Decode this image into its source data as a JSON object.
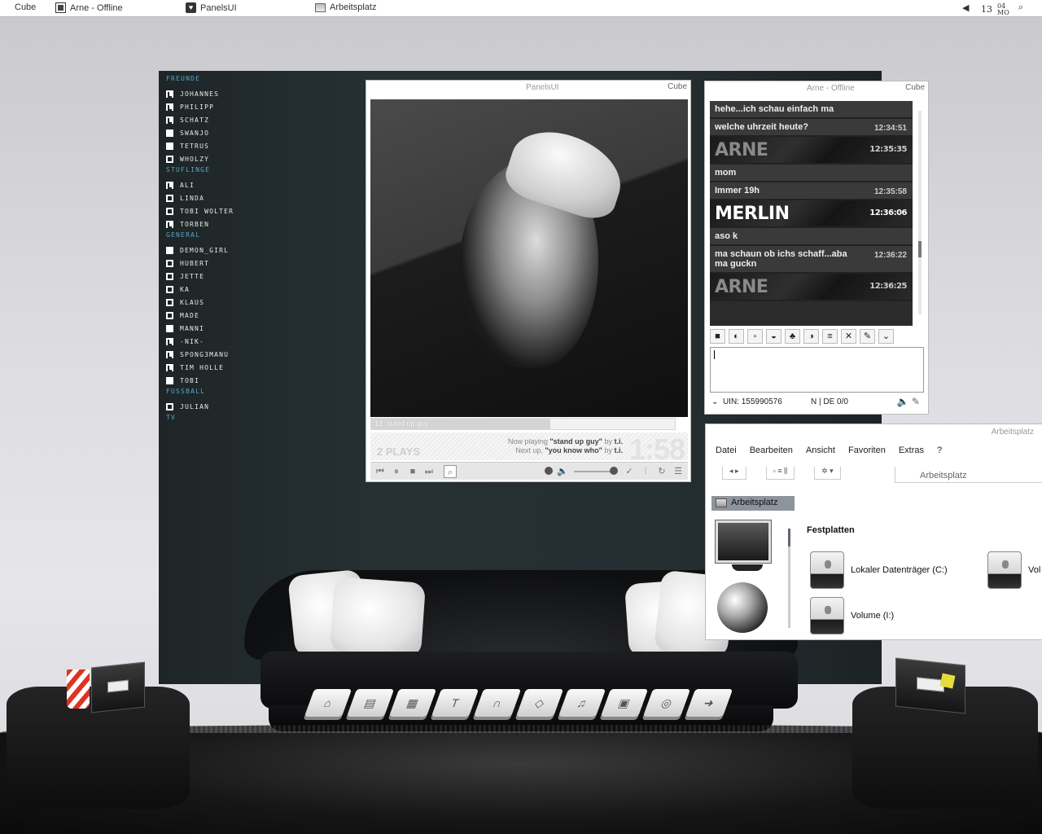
{
  "taskbar": {
    "cube_label": "Cube",
    "items": [
      {
        "label": "Arne - Offline",
        "icon": "square-icon"
      },
      {
        "label": "PanelsUI",
        "icon": "heart-icon"
      },
      {
        "label": "Arbeitsplatz",
        "icon": "monitor-icon"
      }
    ],
    "clock": {
      "day": "13",
      "month": "04",
      "weekday": "MO"
    }
  },
  "buddy_list": {
    "groups": [
      {
        "name": "FREUNDE",
        "contacts": [
          {
            "name": "JOHANNES",
            "status": "away"
          },
          {
            "name": "PHILIPP",
            "status": "away"
          },
          {
            "name": "SCHATZ",
            "status": "away"
          },
          {
            "name": "SWANJO",
            "status": "offline"
          },
          {
            "name": "TETRUS",
            "status": "offline"
          },
          {
            "name": "WHOLZY",
            "status": "online"
          }
        ]
      },
      {
        "name": "STUFLINGE",
        "contacts": [
          {
            "name": "ALI",
            "status": "away"
          },
          {
            "name": "LINDA",
            "status": "online"
          },
          {
            "name": "TOBI WOLTER",
            "status": "online"
          },
          {
            "name": "TORBEN",
            "status": "away"
          }
        ]
      },
      {
        "name": "GENERAL",
        "contacts": [
          {
            "name": "DEMON_GIRL",
            "status": "offline"
          },
          {
            "name": "HUBERT",
            "status": "online"
          },
          {
            "name": "JETTE",
            "status": "online"
          },
          {
            "name": "KA",
            "status": "online"
          },
          {
            "name": "KLAUS",
            "status": "online"
          },
          {
            "name": "MADE",
            "status": "online"
          },
          {
            "name": "MANNI",
            "status": "offline"
          },
          {
            "name": "-NIK-",
            "status": "away"
          },
          {
            "name": "SPONG3MANU",
            "status": "away"
          },
          {
            "name": "TIM HOLLE",
            "status": "away"
          },
          {
            "name": "TOBI",
            "status": "offline"
          }
        ]
      },
      {
        "name": "FUSSBALL",
        "contacts": [
          {
            "name": "JULIAN",
            "status": "online"
          }
        ]
      },
      {
        "name": "TV",
        "contacts": []
      }
    ]
  },
  "player": {
    "title": "PanelsUI",
    "cube": "Cube",
    "track": "13. stand up guy",
    "progress": 0.59,
    "plays": "2 PLAYS",
    "now_playing_prefix": "Now playing",
    "now_playing_title": "\"stand up guy\"",
    "now_playing_by": "by",
    "now_playing_artist": "t.i.",
    "next_prefix": "Next up,",
    "next_title": "\"you know who\"",
    "next_by": "by",
    "next_artist": "t.i.",
    "time": "1:58"
  },
  "chat": {
    "title": "Arne - Offline",
    "cube": "Cube",
    "messages": [
      {
        "type": "text",
        "text": "hehe...ich schau einfach ma",
        "time": ""
      },
      {
        "type": "text",
        "text": "welche uhrzeit heute?",
        "time": "12:34:51"
      },
      {
        "type": "name",
        "text": "ARNE",
        "time": "12:35:35",
        "who": "arne"
      },
      {
        "type": "text",
        "text": "mom",
        "time": ""
      },
      {
        "type": "text",
        "text": "Immer 19h",
        "time": "12:35:58"
      },
      {
        "type": "name",
        "text": "MERLIN",
        "time": "12:36:06",
        "who": "merlin"
      },
      {
        "type": "text",
        "text": "aso k",
        "time": ""
      },
      {
        "type": "text",
        "text": "ma schaun ob ichs schaff...aba ma guckn",
        "time": "12:36:22"
      },
      {
        "type": "name",
        "text": "ARNE",
        "time": "12:36:25",
        "who": "arne"
      }
    ],
    "uin": "UIN: 155990576",
    "status_right": "N | DE 0/0"
  },
  "explorer": {
    "title": "Arbeitsplatz",
    "menu": [
      "Datei",
      "Bearbeiten",
      "Ansicht",
      "Favoriten",
      "Extras",
      "?"
    ],
    "address": "Arbeitsplatz",
    "crumb": "Arbeitsplatz",
    "section": "Festplatten",
    "drives": [
      "Lokaler Datenträger (C:)",
      "Vol",
      "Volume (I:)"
    ]
  },
  "dock": [
    "home-icon",
    "news-icon",
    "grid-icon",
    "text-icon",
    "headphones-icon",
    "tag-icon",
    "music-icon",
    "camera-icon",
    "disc-icon",
    "arrow-icon"
  ]
}
